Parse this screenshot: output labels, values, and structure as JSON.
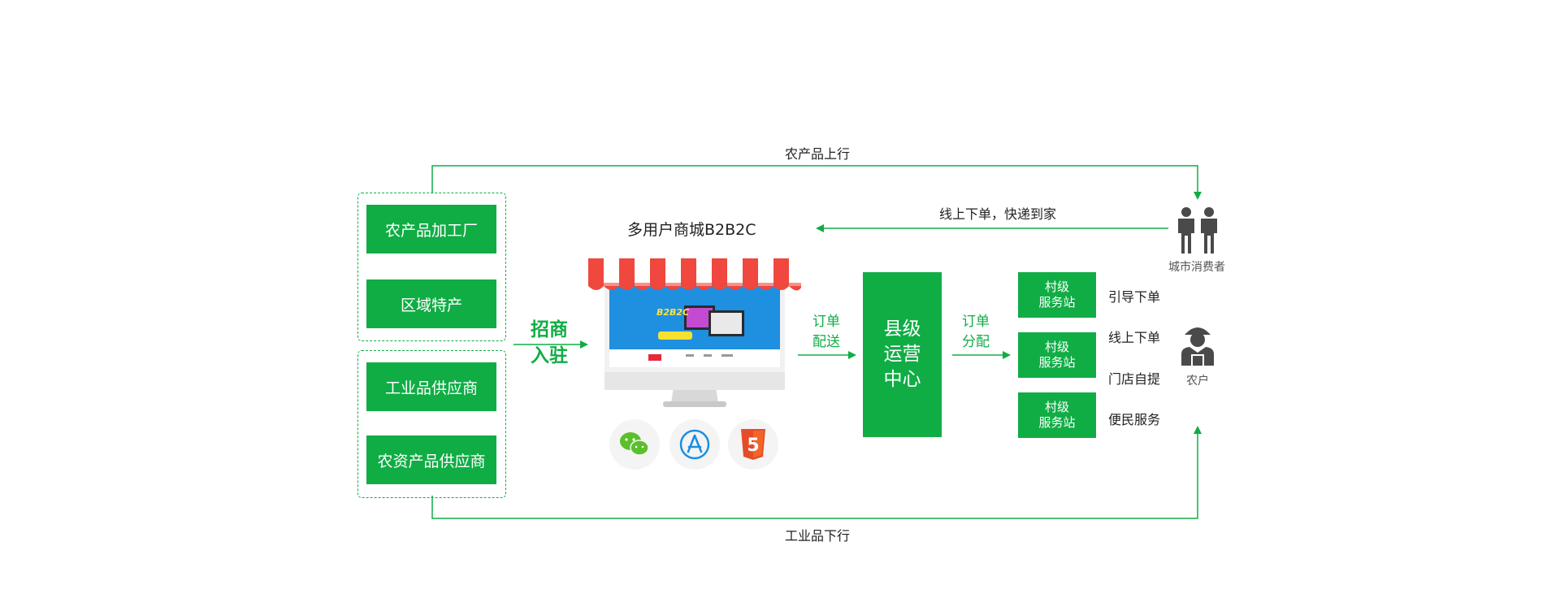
{
  "flows": {
    "top_label": "农产品上行",
    "bottom_label": "工业品下行",
    "online_label": "线上下单，快递到家"
  },
  "suppliers": {
    "upper": [
      "农产品加工厂",
      "区域特产"
    ],
    "lower": [
      "工业品供应商",
      "农资产品供应商"
    ]
  },
  "recruit": {
    "line1": "招商",
    "line2": "入驻"
  },
  "mall": {
    "title": "多用户商城B2B2C",
    "screen_banner": "B2B2C",
    "icons": [
      "wechat-icon",
      "app-store-icon",
      "html5-icon"
    ],
    "html5_glyph": "5"
  },
  "order_delivery": {
    "line1": "订单",
    "line2": "配送"
  },
  "county_center": {
    "line1": "县级",
    "line2": "运营",
    "line3": "中心"
  },
  "order_distribution": {
    "line1": "订单",
    "line2": "分配"
  },
  "stations": [
    {
      "line1": "村级",
      "line2": "服务站"
    },
    {
      "line1": "村级",
      "line2": "服务站"
    },
    {
      "line1": "村级",
      "line2": "服务站"
    }
  ],
  "services": [
    "引导下单",
    "线上下单",
    "门店自提",
    "便民服务"
  ],
  "actors": {
    "consumer": "城市消费者",
    "farmer": "农户"
  },
  "colors": {
    "green": "#10ad45",
    "awning_red": "#f0483e",
    "screen_blue": "#1f8fe0",
    "actor_gray": "#4a4a4a"
  }
}
